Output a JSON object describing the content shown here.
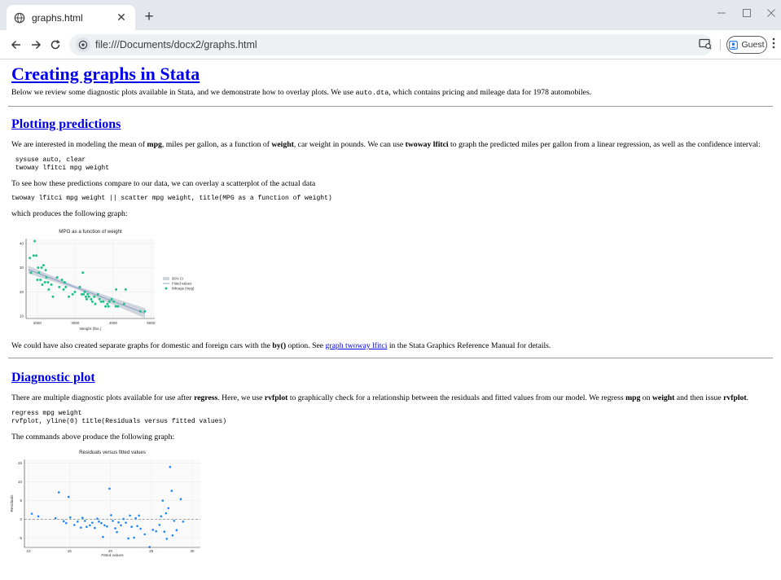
{
  "browser": {
    "tab_title": "graphs.html",
    "tab_close": "✕",
    "new_tab": "+",
    "url": "file:///Documents/docx2/graphs.html",
    "profile_label": "Guest",
    "icons": [
      "globe-icon",
      "back-arrow-icon",
      "forward-arrow-icon",
      "reload-icon",
      "site-info-icon",
      "cast-icon",
      "person-icon",
      "kebab-menu-icon"
    ]
  },
  "page": {
    "title": "Creating graphs in Stata",
    "intro_pre": "Below we review some diagnostic plots available in Stata, and we demonstrate how to overlay plots. We use ",
    "intro_code": "auto.dta",
    "intro_post": ", which contains pricing and mileage data for 1978 automobiles.",
    "section1": {
      "heading": "Plotting predictions",
      "p1_a": "We are interested in modeling the mean of ",
      "p1_b": "mpg",
      "p1_c": ", miles per gallon, as a function of ",
      "p1_d": "weight",
      "p1_e": ", car weight in pounds. We can use ",
      "p1_f": "twoway lfitci",
      "p1_g": " to graph the predicted miles per gallon from a linear regression, as well as the confidence interval:",
      "code1": " sysuse auto, clear\n twoway lfitci mpg weight",
      "p2": "To see how these predictions compare to our data, we can overlay a scatterplot of the actual data",
      "code2": "twoway lfitci mpg weight || scatter mpg weight, title(MPG as a function of weight)",
      "p3": "which produces the following graph:",
      "p4_a": "We could have also created separate graphs for domestic and foreign cars with the ",
      "p4_b": "by()",
      "p4_c": " option. See ",
      "p4_link": "graph twoway lfitci",
      "p4_d": " in the Stata Graphics Reference Manual for details."
    },
    "section2": {
      "heading": "Diagnostic plot",
      "p1_a": "There are multiple diagnostic plots available for use after ",
      "p1_b": "regress",
      "p1_c": ". Here, we use ",
      "p1_d": "rvfplot",
      "p1_e": " to graphically check for a relationship between the residuals and fitted values from our model. We regress ",
      "p1_f": "mpg",
      "p1_g": " on ",
      "p1_h": "weight",
      "p1_i": " and then issue ",
      "p1_j": "rvfplot",
      "p1_k": ".",
      "code": "regress mpg weight\nrvfplot, yline(0) title(Residuals versus fitted values)",
      "p2": "The commands above produce the following graph:"
    }
  },
  "chart_data": [
    {
      "type": "scatter",
      "title": "MPG as a function of weight",
      "xlabel": "Weight (lbs.)",
      "ylabel": "",
      "xlim": [
        1700,
        5100
      ],
      "ylim": [
        9,
        42
      ],
      "xticks": [
        2000,
        3000,
        4000,
        5000
      ],
      "yticks": [
        10,
        20,
        30,
        40
      ],
      "legend": [
        "95% CI",
        "Fitted values",
        "Mileage (mpg)"
      ],
      "legend_position": "right",
      "colors": {
        "ci": "#d0d4dc",
        "fit": "#8aa2c8",
        "points": "#1fc08a"
      },
      "fit": {
        "x": [
          1760,
          4840
        ],
        "y": [
          29.2,
          11.2
        ]
      },
      "ci_upper": [
        [
          1760,
          30.8
        ],
        [
          3000,
          22.6
        ],
        [
          4840,
          13.3
        ]
      ],
      "ci_lower": [
        [
          1760,
          27.6
        ],
        [
          3000,
          21.3
        ],
        [
          4840,
          9.2
        ]
      ],
      "series": [
        {
          "name": "Mileage (mpg)",
          "points": [
            [
              1800,
              34
            ],
            [
              1830,
              28
            ],
            [
              1900,
              35
            ],
            [
              1930,
              41
            ],
            [
              1970,
              35
            ],
            [
              2000,
              25
            ],
            [
              2020,
              30
            ],
            [
              2040,
              28
            ],
            [
              2080,
              25
            ],
            [
              2110,
              30
            ],
            [
              2130,
              23
            ],
            [
              2160,
              31
            ],
            [
              2200,
              24
            ],
            [
              2220,
              29
            ],
            [
              2240,
              26
            ],
            [
              2280,
              24
            ],
            [
              2300,
              21
            ],
            [
              2370,
              23
            ],
            [
              2410,
              18
            ],
            [
              2520,
              26
            ],
            [
              2580,
              22
            ],
            [
              2650,
              25
            ],
            [
              2690,
              21
            ],
            [
              2720,
              24
            ],
            [
              2750,
              22
            ],
            [
              2830,
              18
            ],
            [
              2930,
              19
            ],
            [
              2990,
              20
            ],
            [
              3120,
              22
            ],
            [
              3170,
              19
            ],
            [
              3200,
              28
            ],
            [
              3220,
              19
            ],
            [
              3250,
              20
            ],
            [
              3280,
              18
            ],
            [
              3300,
              17
            ],
            [
              3330,
              19
            ],
            [
              3360,
              18
            ],
            [
              3420,
              17
            ],
            [
              3450,
              16
            ],
            [
              3500,
              18
            ],
            [
              3530,
              15
            ],
            [
              3600,
              19
            ],
            [
              3640,
              17
            ],
            [
              3680,
              16
            ],
            [
              3740,
              16
            ],
            [
              3800,
              14
            ],
            [
              3850,
              15
            ],
            [
              3880,
              14
            ],
            [
              3900,
              16
            ],
            [
              3960,
              17
            ],
            [
              4020,
              16
            ],
            [
              4070,
              14
            ],
            [
              4080,
              21
            ],
            [
              4130,
              14
            ],
            [
              4290,
              15
            ],
            [
              4330,
              21
            ],
            [
              4720,
              12
            ],
            [
              4840,
              12
            ]
          ]
        }
      ]
    },
    {
      "type": "scatter",
      "title": "Residuals versus fitted values",
      "xlabel": "Fitted values",
      "ylabel": "Residuals",
      "xlim": [
        9.5,
        31
      ],
      "ylim": [
        -7.5,
        16
      ],
      "xticks": [
        10,
        15,
        20,
        25,
        30
      ],
      "yticks": [
        -5,
        0,
        5,
        10,
        15
      ],
      "yline": 0,
      "colors": {
        "points": "#1a85ff",
        "yline": "#8c8c8c"
      },
      "series": [
        {
          "name": "",
          "points": [
            [
              10.4,
              1.5
            ],
            [
              11.2,
              0.8
            ],
            [
              13.3,
              0.3
            ],
            [
              13.7,
              7.2
            ],
            [
              14.3,
              -0.5
            ],
            [
              14.6,
              -1.0
            ],
            [
              14.9,
              6.0
            ],
            [
              15.1,
              0.5
            ],
            [
              15.6,
              -1.5
            ],
            [
              16.0,
              -0.6
            ],
            [
              16.4,
              -2.2
            ],
            [
              16.6,
              0.4
            ],
            [
              16.9,
              -0.4
            ],
            [
              17.1,
              -2.0
            ],
            [
              17.5,
              -1.6
            ],
            [
              17.8,
              -0.9
            ],
            [
              18.1,
              -2.3
            ],
            [
              18.4,
              0.2
            ],
            [
              18.6,
              -0.6
            ],
            [
              18.9,
              -1.0
            ],
            [
              19.1,
              -4.7
            ],
            [
              19.3,
              -1.6
            ],
            [
              19.6,
              -1.9
            ],
            [
              19.9,
              8.2
            ],
            [
              20.1,
              1.1
            ],
            [
              20.3,
              -0.4
            ],
            [
              20.6,
              -2.4
            ],
            [
              20.8,
              -3.4
            ],
            [
              21.0,
              -0.8
            ],
            [
              21.3,
              -1.6
            ],
            [
              21.6,
              0.1
            ],
            [
              21.9,
              -0.9
            ],
            [
              22.2,
              -5.1
            ],
            [
              22.4,
              1.0
            ],
            [
              22.6,
              -2.0
            ],
            [
              22.9,
              -4.9
            ],
            [
              23.1,
              0.3
            ],
            [
              23.3,
              -1.8
            ],
            [
              23.5,
              1.0
            ],
            [
              23.7,
              -2.5
            ],
            [
              24.2,
              -4.0
            ],
            [
              24.8,
              -7.4
            ],
            [
              25.2,
              -2.8
            ],
            [
              25.6,
              -3.2
            ],
            [
              26.0,
              -1.5
            ],
            [
              26.2,
              0.8
            ],
            [
              26.4,
              5.0
            ],
            [
              26.6,
              -3.3
            ],
            [
              26.8,
              1.6
            ],
            [
              26.9,
              -5.2
            ],
            [
              27.1,
              3.0
            ],
            [
              27.3,
              14.0
            ],
            [
              27.5,
              7.6
            ],
            [
              27.6,
              -4.3
            ],
            [
              27.8,
              -0.4
            ],
            [
              28.1,
              -2.9
            ],
            [
              28.6,
              5.4
            ],
            [
              28.9,
              -0.6
            ]
          ]
        }
      ]
    }
  ]
}
